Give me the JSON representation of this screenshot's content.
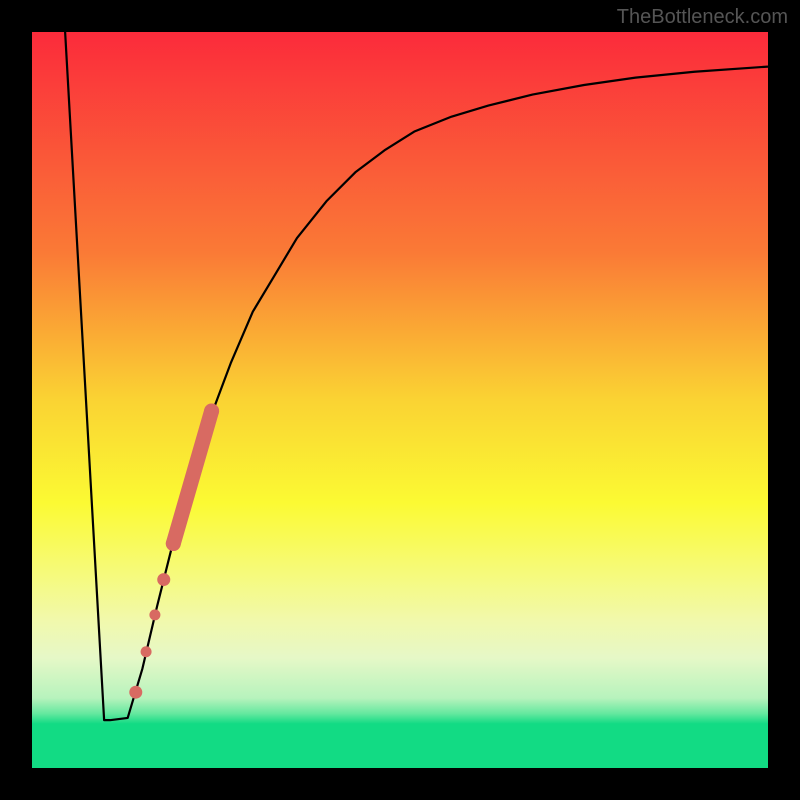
{
  "watermark": "TheBottleneck.com",
  "chart_data": {
    "type": "line",
    "title": "",
    "xlabel": "",
    "ylabel": "",
    "xlim": [
      0,
      100
    ],
    "ylim": [
      0,
      100
    ],
    "background_gradient": {
      "stops": [
        {
          "offset": 0.0,
          "color": "#fb2b3b"
        },
        {
          "offset": 0.3,
          "color": "#fa7a36"
        },
        {
          "offset": 0.5,
          "color": "#fad333"
        },
        {
          "offset": 0.64,
          "color": "#fbfa33"
        },
        {
          "offset": 0.72,
          "color": "#f7fa6f"
        },
        {
          "offset": 0.8,
          "color": "#f1f9ac"
        },
        {
          "offset": 0.85,
          "color": "#e6f8c7"
        },
        {
          "offset": 0.905,
          "color": "#b7f3bd"
        },
        {
          "offset": 0.926,
          "color": "#65e89f"
        },
        {
          "offset": 0.94,
          "color": "#12db84"
        },
        {
          "offset": 1.0,
          "color": "#12db84"
        }
      ]
    },
    "series": [
      {
        "name": "bottleneck-curve",
        "color": "#000000",
        "x": [
          4.5,
          9.8,
          10.6,
          13.0,
          15.0,
          17.0,
          19.0,
          21.5,
          24.0,
          27.0,
          30.0,
          33.0,
          36.0,
          40.0,
          44.0,
          48.0,
          52.0,
          57.0,
          62.0,
          68.0,
          75.0,
          82.0,
          90.0,
          100.0
        ],
        "y": [
          100.0,
          6.5,
          6.5,
          6.8,
          13.5,
          22.0,
          30.0,
          39.0,
          47.0,
          55.0,
          62.0,
          67.0,
          72.0,
          77.0,
          81.0,
          84.0,
          86.5,
          88.5,
          90.0,
          91.5,
          92.8,
          93.8,
          94.6,
          95.3
        ]
      }
    ],
    "highlight_points": {
      "name": "bottleneck-markers",
      "color": "#d86a62",
      "segment": {
        "x": [
          19.2,
          24.4
        ],
        "y": [
          30.5,
          48.5
        ]
      },
      "end_radius": 7.5,
      "dots": [
        {
          "x": 17.9,
          "y": 25.6,
          "r": 6.5
        },
        {
          "x": 16.7,
          "y": 20.8,
          "r": 5.5
        },
        {
          "x": 15.5,
          "y": 15.8,
          "r": 5.5
        },
        {
          "x": 14.1,
          "y": 10.3,
          "r": 6.5
        }
      ]
    }
  }
}
